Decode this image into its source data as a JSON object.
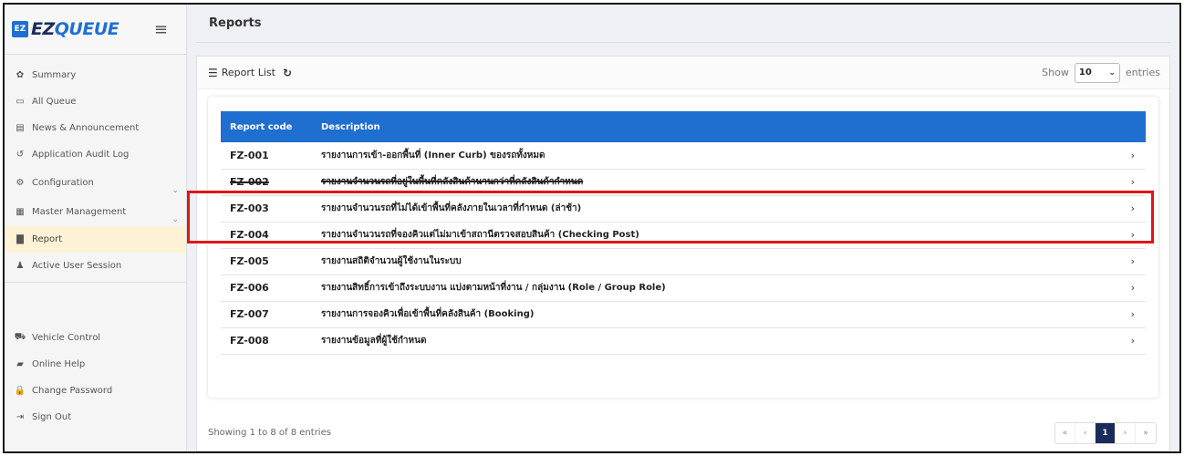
{
  "brand": {
    "logo_mark": "EZ",
    "name_ez": "EZ",
    "name_queue": "QUEUE"
  },
  "sidebar": {
    "items": [
      {
        "icon": "dashboard-icon",
        "glyph": "✿",
        "label": "Summary"
      },
      {
        "icon": "monitor-icon",
        "glyph": "▭",
        "label": "All Queue"
      },
      {
        "icon": "newspaper-icon",
        "glyph": "▤",
        "label": "News & Announcement"
      },
      {
        "icon": "history-icon",
        "glyph": "↺",
        "label": "Application Audit Log"
      },
      {
        "icon": "cogs-icon",
        "glyph": "⚙",
        "label": "Configuration"
      },
      {
        "icon": "table-icon",
        "glyph": "▦",
        "label": "Master Management"
      },
      {
        "icon": "file-icon",
        "glyph": "▇",
        "label": "Report"
      },
      {
        "icon": "user-icon",
        "glyph": "♟",
        "label": "Active User Session"
      }
    ],
    "bottom_items": [
      {
        "icon": "truck-icon",
        "glyph": "⛟",
        "label": "Vehicle Control"
      },
      {
        "icon": "book-icon",
        "glyph": "▰",
        "label": "Online Help"
      },
      {
        "icon": "lock-icon",
        "glyph": "🔒",
        "label": "Change Password"
      },
      {
        "icon": "sign-out-icon",
        "glyph": "⇥",
        "label": "Sign Out"
      }
    ]
  },
  "page": {
    "title": "Reports"
  },
  "panel": {
    "title": "Report List",
    "show_label": "Show",
    "entries_value": "10",
    "entries_label": "entries"
  },
  "table": {
    "headers": {
      "code": "Report code",
      "description": "Description"
    },
    "rows": [
      {
        "code": "FZ-001",
        "description": "รายงานการเข้า-ออกพื้นที่ (Inner Curb) ของรถทั้งหมด"
      },
      {
        "code": "FZ-002",
        "description": "รายงานจำนวนรถที่อยู่ในพื้นที่คลังสินค้านานกว่าที่คลังสินค้ากำหนด"
      },
      {
        "code": "FZ-003",
        "description": "รายงานจำนวนรถที่ไม่ได้เข้าพื้นที่คลังภายในเวลาที่กำหนด (ล่าช้า)"
      },
      {
        "code": "FZ-004",
        "description": "รายงานจำนวนรถที่จองคิวแต่ไม่มาเข้าสถานีตรวจสอบสินค้า (Checking Post)"
      },
      {
        "code": "FZ-005",
        "description": "รายงานสถิติจำนวนผู้ใช้งานในระบบ"
      },
      {
        "code": "FZ-006",
        "description": "รายงานสิทธิ์การเข้าถึงระบบงาน แบ่งตามหน้าที่งาน / กลุ่มงาน (Role / Group Role)"
      },
      {
        "code": "FZ-007",
        "description": "รายงานการจองคิวเพื่อเข้าพื้นที่คลังสินค้า (Booking)"
      },
      {
        "code": "FZ-008",
        "description": "รายงานข้อมูลที่ผู้ใช้กำหนด"
      }
    ]
  },
  "footer": {
    "info": "Showing 1 to 8 of 8 entries",
    "pager": {
      "first": "«",
      "prev": "‹",
      "current": "1",
      "next": "›",
      "last": "»"
    }
  },
  "colors": {
    "primary": "#1f6fd1",
    "highlight": "#e01515",
    "active_menu": "#fdf2d6",
    "brand_dark": "#1a2c5b"
  }
}
